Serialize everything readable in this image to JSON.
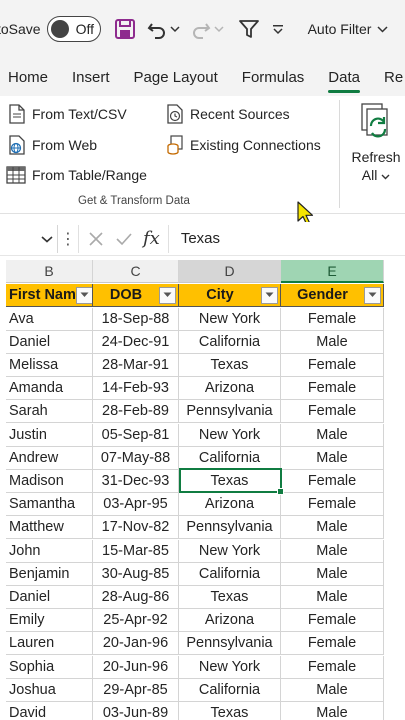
{
  "qat": {
    "autosave_label": "toSave",
    "autosave_state": "Off",
    "autofilter_label": "Auto Filter"
  },
  "tabs": [
    "Home",
    "Insert",
    "Page Layout",
    "Formulas",
    "Data",
    "Re"
  ],
  "active_tab": "Data",
  "ribbon": {
    "from_text_csv": "From Text/CSV",
    "from_web": "From Web",
    "from_table_range": "From Table/Range",
    "recent_sources": "Recent Sources",
    "existing_connections": "Existing Connections",
    "group_label": "Get & Transform Data",
    "refresh_label": "Refresh",
    "refresh_all_label": "All"
  },
  "formula_bar": {
    "value": "Texas"
  },
  "grid": {
    "column_letters": [
      "B",
      "C",
      "D",
      "E"
    ],
    "headers": [
      "First Nam",
      "DOB",
      "City",
      "Gender"
    ],
    "rows": [
      [
        "Ava",
        "18-Sep-88",
        "New York",
        "Female"
      ],
      [
        "Daniel",
        "24-Dec-91",
        "California",
        "Male"
      ],
      [
        "Melissa",
        "28-Mar-91",
        "Texas",
        "Female"
      ],
      [
        "Amanda",
        "14-Feb-93",
        "Arizona",
        "Female"
      ],
      [
        "Sarah",
        "28-Feb-89",
        "Pennsylvania",
        "Female"
      ],
      [
        "Justin",
        "05-Sep-81",
        "New York",
        "Male"
      ],
      [
        "Andrew",
        "07-May-88",
        "California",
        "Male"
      ],
      [
        "Madison",
        "31-Dec-93",
        "Texas",
        "Female"
      ],
      [
        "Samantha",
        "03-Apr-95",
        "Arizona",
        "Female"
      ],
      [
        "Matthew",
        "17-Nov-82",
        "Pennsylvania",
        "Male"
      ],
      [
        "John",
        "15-Mar-85",
        "New York",
        "Male"
      ],
      [
        "Benjamin",
        "30-Aug-85",
        "California",
        "Male"
      ],
      [
        "Daniel",
        "28-Aug-86",
        "Texas",
        "Male"
      ],
      [
        "Emily",
        "25-Apr-92",
        "Arizona",
        "Female"
      ],
      [
        "Lauren",
        "20-Jan-96",
        "Pennsylvania",
        "Female"
      ],
      [
        "Sophia",
        "20-Jun-96",
        "New York",
        "Female"
      ],
      [
        "Joshua",
        "29-Apr-85",
        "California",
        "Male"
      ],
      [
        "David",
        "03-Jun-89",
        "Texas",
        "Male"
      ]
    ]
  },
  "colors": {
    "accent": "#107c41",
    "header_fill": "#ffc000",
    "save_icon": "#8e2b8e"
  }
}
